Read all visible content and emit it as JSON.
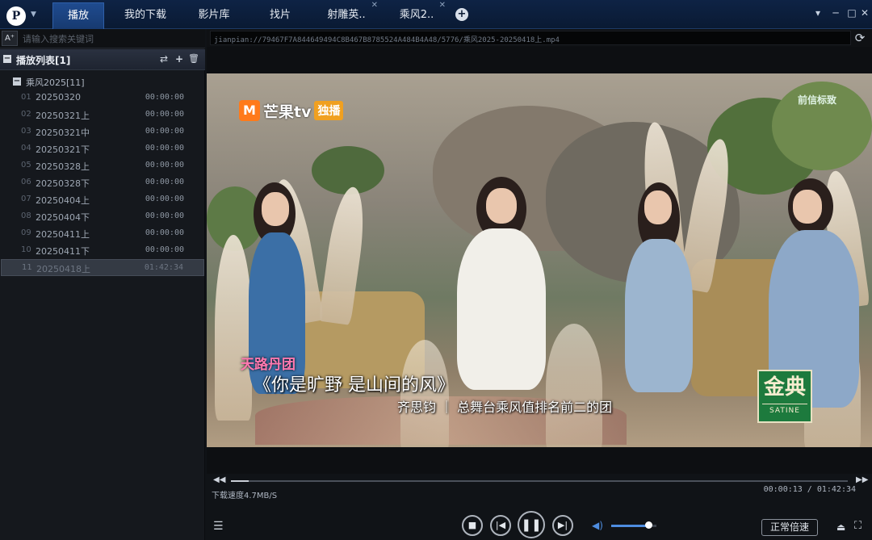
{
  "app": {
    "logo_glyph": "P",
    "accent": "#1f4b8f"
  },
  "tabs": [
    {
      "label": "播放",
      "active": true,
      "closable": false
    },
    {
      "label": "我的下载",
      "active": false,
      "closable": false
    },
    {
      "label": "影片库",
      "active": false,
      "closable": false
    },
    {
      "label": "找片",
      "active": false,
      "closable": false
    },
    {
      "label": "射雕英..",
      "active": false,
      "closable": true
    },
    {
      "label": "乘风2..",
      "active": false,
      "closable": true
    }
  ],
  "window_buttons": {
    "menu": "▾",
    "minimize": "─",
    "maximize": "□",
    "close": "✕"
  },
  "sidebar": {
    "font_button": "A⁺",
    "search_placeholder": "请输入搜索关键词",
    "playlist_title": "播放列表[1]",
    "group_label": "乘风2025[11]",
    "items": [
      {
        "idx": "01",
        "name": "20250320",
        "duration": "00:00:00"
      },
      {
        "idx": "02",
        "name": "20250321上",
        "duration": "00:00:00"
      },
      {
        "idx": "03",
        "name": "20250321中",
        "duration": "00:00:00"
      },
      {
        "idx": "04",
        "name": "20250321下",
        "duration": "00:00:00"
      },
      {
        "idx": "05",
        "name": "20250328上",
        "duration": "00:00:00"
      },
      {
        "idx": "06",
        "name": "20250328下",
        "duration": "00:00:00"
      },
      {
        "idx": "07",
        "name": "20250404上",
        "duration": "00:00:00"
      },
      {
        "idx": "08",
        "name": "20250404下",
        "duration": "00:00:00"
      },
      {
        "idx": "09",
        "name": "20250411上",
        "duration": "00:00:00"
      },
      {
        "idx": "10",
        "name": "20250411下",
        "duration": "00:00:00"
      },
      {
        "idx": "11",
        "name": "20250418上",
        "duration": "01:42:34",
        "active": true
      }
    ]
  },
  "url": "jianpian://79467F7A844649494C8B467B8785524A484B4A48/5776/乘风2025-20250418上.mp4",
  "video": {
    "channel_logo": "芒果tv",
    "channel_badge": "独播",
    "corner_logo": "前信标致",
    "team_label": "天路丹团",
    "song_title": "《你是旷野 是山间的风》",
    "subtitle": "齐思钧 ｜ 总舞台乘风值排名前二的团",
    "sponsor_main": "金典",
    "sponsor_sub": "SATINE"
  },
  "player": {
    "download_speed": "下载速度4.7MB/S",
    "current_time": "00:00:13",
    "total_time": "01:42:34",
    "time_display": "00:00:13 / 01:42:34",
    "progress_fraction": 0.0021,
    "volume_fraction": 0.82,
    "rate_label": "正常倍速"
  }
}
